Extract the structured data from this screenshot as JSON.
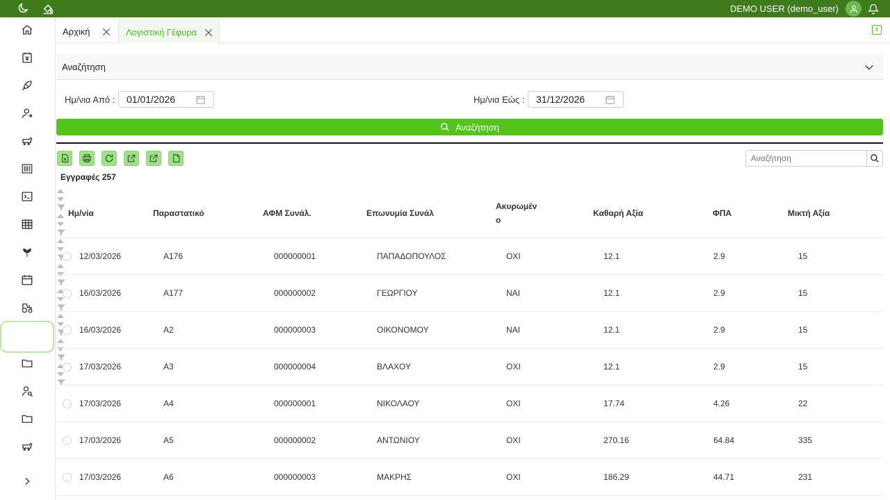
{
  "header": {
    "user": "DEMO USER (demo_user)"
  },
  "tabs": [
    {
      "label": "Αρχική"
    },
    {
      "label": "Λογιστική Γέφυρα"
    }
  ],
  "search_panel": {
    "title": "Αναζήτηση",
    "date_from_label": "Ημ/νια Από :",
    "date_from_value": "01/01/2026",
    "date_to_label": "Ημ/νια Εώς :",
    "date_to_value": "31/12/2026",
    "search_button": "Αναζήτηση"
  },
  "quick_search": {
    "placeholder": "Αναζήτηση"
  },
  "records_label": "Εγγραφές 257",
  "table": {
    "columns": [
      "Ημ/νία",
      "Παραστατικό",
      "ΑΦΜ Συνάλ.",
      "Επωνυμία Συνάλ",
      "Ακυρωμέν\nο",
      "Καθαρή Αξία",
      "ΦΠΑ",
      "Μικτή Αξία"
    ],
    "rows": [
      [
        "12/03/2026",
        "A176",
        "000000001",
        "ΠΑΠΑΔΟΠΟΥΛΟΣ",
        "ΟΧΙ",
        "12.1",
        "2.9",
        "15"
      ],
      [
        "16/03/2026",
        "A177",
        "000000002",
        "ΓΕΩΡΓΙΟΥ",
        "ΝΑΙ",
        "12.1",
        "2.9",
        "15"
      ],
      [
        "16/03/2026",
        "A2",
        "000000003",
        "ΟΙΚΟΝΟΜΟΥ",
        "ΝΑΙ",
        "12.1",
        "2.9",
        "15"
      ],
      [
        "17/03/2026",
        "A3",
        "000000004",
        "ΒΛΑΧΟΥ",
        "ΟΧΙ",
        "12.1",
        "2.9",
        "15"
      ],
      [
        "17/03/2026",
        "A4",
        "000000001",
        "ΝΙΚΟΛΑΟΥ",
        "ΟΧΙ",
        "17.74",
        "4.26",
        "22"
      ],
      [
        "17/03/2026",
        "A5",
        "000000002",
        "ΑΝΤΩΝΙΟΥ",
        "ΟΧΙ",
        "270.16",
        "64.84",
        "335"
      ],
      [
        "17/03/2026",
        "A6",
        "000000003",
        "ΜΑΚΡΗΣ",
        "ΟΧΙ",
        "186.29",
        "44.71",
        "231"
      ]
    ]
  },
  "colors": {
    "header_bg": "#3f7a1d",
    "accent": "#52c41a",
    "tool_bg": "#9fe08a"
  },
  "sidebar_icons": [
    "home-icon",
    "invoice-icon",
    "feather-icon",
    "user-switch-icon",
    "livestock-icon",
    "barcode-icon",
    "terminal-icon",
    "table-icon",
    "seedling-icon",
    "calendar-icon",
    "tractor-icon",
    "empty-slot",
    "folder-icon",
    "user-search-icon",
    "folder-icon",
    "livestock-icon",
    "expand-icon"
  ]
}
